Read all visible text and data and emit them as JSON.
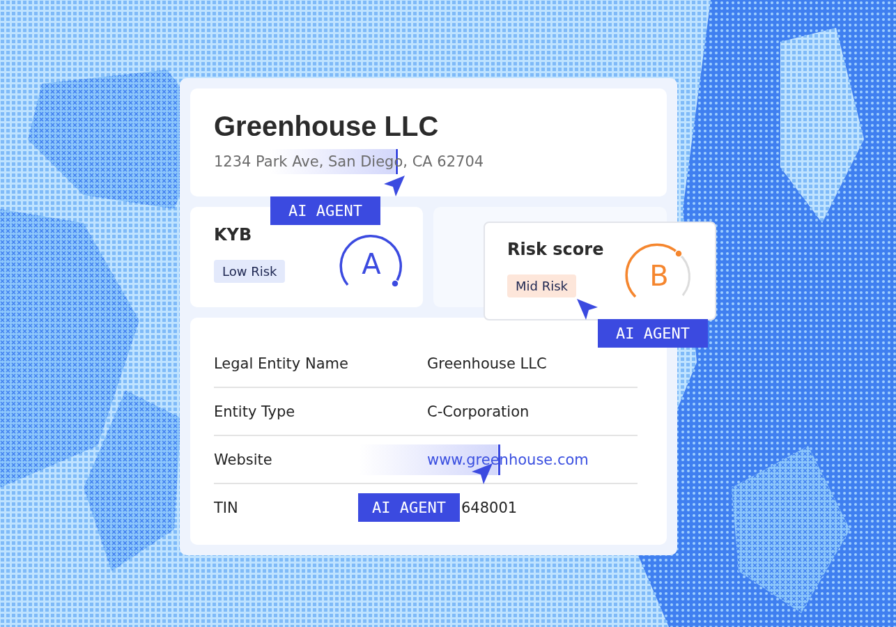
{
  "company": {
    "name": "Greenhouse LLC",
    "address": "1234 Park Ave, San Diego, CA 62704",
    "agent_tag": "AI AGENT"
  },
  "kyb": {
    "title": "KYB",
    "badge": "Low Risk",
    "grade": "A"
  },
  "risk_score": {
    "title": "Risk score",
    "badge": "Mid Risk",
    "grade": "B",
    "agent_tag": "AI AGENT"
  },
  "details": [
    {
      "label": "Legal Entity Name",
      "value": "Greenhouse LLC",
      "kind": "text"
    },
    {
      "label": "Entity Type",
      "value": "C-Corporation",
      "kind": "text"
    },
    {
      "label": "Website",
      "value": "www.greenhouse.com",
      "kind": "link"
    },
    {
      "label": "TIN",
      "value": "648001",
      "kind": "text"
    }
  ],
  "details_agent_tag": "AI AGENT"
}
